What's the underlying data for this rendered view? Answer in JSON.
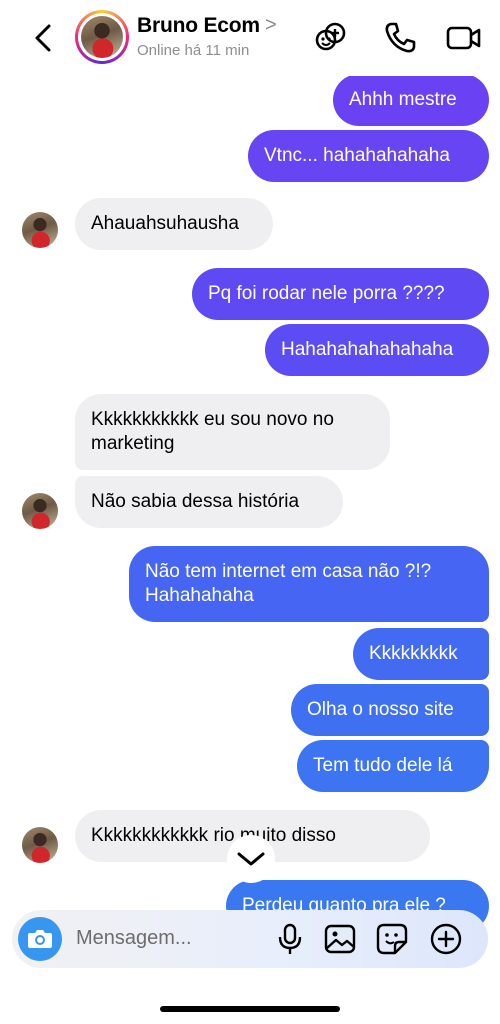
{
  "header": {
    "contact_name": "Bruno Ecom",
    "name_chevron": ">",
    "status": "Online há 11 min"
  },
  "messages": [
    {
      "side": "out",
      "text": "Ahhh mestre"
    },
    {
      "side": "out",
      "text": "Vtnc... hahahahahaha"
    },
    {
      "side": "in",
      "text": "Ahauahsuhausha"
    },
    {
      "side": "out",
      "text": "Pq foi rodar nele porra ????"
    },
    {
      "side": "out",
      "text": "Hahahahahahahaha"
    },
    {
      "side": "in",
      "text": "Kkkkkkkkkkk eu sou novo no\nmarketing"
    },
    {
      "side": "in",
      "text": "Não sabia dessa história"
    },
    {
      "side": "out",
      "text": "Não tem internet em casa não ?!?\nHahahahaha"
    },
    {
      "side": "out",
      "text": "Kkkkkkkkk"
    },
    {
      "side": "out",
      "text": "Olha o nosso site"
    },
    {
      "side": "out",
      "text": "Tem tudo dele lá"
    },
    {
      "side": "in",
      "text": "Kkkkkkkkkkkk    rio muito disso"
    },
    {
      "side": "out",
      "text": "Perdeu quanto pra ele ?"
    }
  ],
  "composer": {
    "placeholder": "Mensagem..."
  },
  "colors": {
    "out_purple": "#6a43f2",
    "out_blue": "#3f6ff2",
    "incoming": "#efeff1",
    "camera": "#3797f0"
  },
  "icons": [
    "back-chevron-icon",
    "group-add-icon",
    "phone-icon",
    "video-icon",
    "camera-icon",
    "microphone-icon",
    "image-icon",
    "sticker-icon",
    "plus-icon",
    "chevron-down-icon"
  ]
}
